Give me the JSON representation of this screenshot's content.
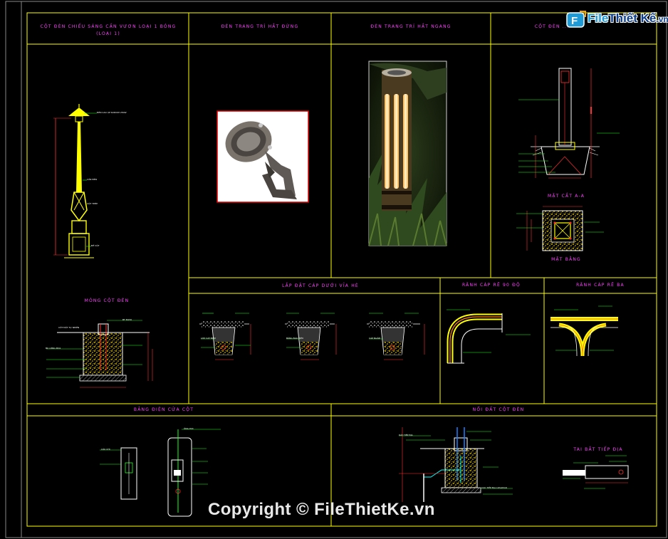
{
  "sheet": {
    "panels": {
      "pole_cantilever": {
        "title": "CỘT ĐÈN CHIẾU SÁNG CẦN VƯƠN LOẠI 1 BÓNG",
        "subtitle": "(LOẠI 1)"
      },
      "ground_light": {
        "title": "ĐÈN TRANG TRÍ HẮT ĐỨNG"
      },
      "bollard_light": {
        "title": "ĐÈN TRANG TRÍ HẮT NGANG"
      },
      "pole_right": {
        "title": "CỘT ĐÈN ..."
      },
      "section_aa": {
        "title": "MẶT CẮT A-A"
      },
      "plan_view": {
        "title": "MẶT BẰNG"
      },
      "foundation": {
        "title": "MÓNG CỘT ĐÈN"
      },
      "cable_laying": {
        "title": "LẮP ĐẶT CÁP DƯỚI VỈA HÈ"
      },
      "trench_90": {
        "title": "RÃNH CÁP RẼ 90 ĐỘ"
      },
      "trench_3way": {
        "title": "RÃNH CÁP RẼ BA"
      },
      "pole_box": {
        "title": "BẢNG ĐIỆN CỬA CỘT"
      },
      "grounding": {
        "title": "NỐI ĐẤT CỘT ĐÈN"
      },
      "ground_detail": {
        "title": "TAI BẮT TIẾP ĐỊA"
      }
    },
    "notes": {
      "lamp_head": "ĐÈN CAO ÁP SODIUM 250W",
      "arm": "CẦN ĐÈN",
      "pole": "CỘT THÉP",
      "base": "ĐẾ CỘT",
      "found_a": "BT M150",
      "found_b": "BU LÔNG M24",
      "found_c": "CỐT ĐẤT TỰ NHIÊN",
      "cable_a": "LỚP CÁT ĐỆM",
      "cable_b": "BĂNG BÁO HIỆU",
      "cable_c": "CÁP NGẦM",
      "ground_a": "CỌC TIẾP ĐỊA L63x63x6",
      "ground_b": "DÂY TIẾP ĐỊA",
      "box_a": "CẦU CHÌ",
      "box_b": "ỐNG PVC"
    }
  },
  "watermark": {
    "text": "Copyright © FileThietKe.vn"
  },
  "logo": {
    "text_a": "File",
    "text_b": "Thiết Kế",
    "text_c": ".vn"
  },
  "colors": {
    "frame": "#ffff00",
    "title": "#ff40ff",
    "outline": "#ffffff",
    "dim": "#ff3030",
    "green": "#20ff20",
    "cyan": "#00ffff"
  }
}
